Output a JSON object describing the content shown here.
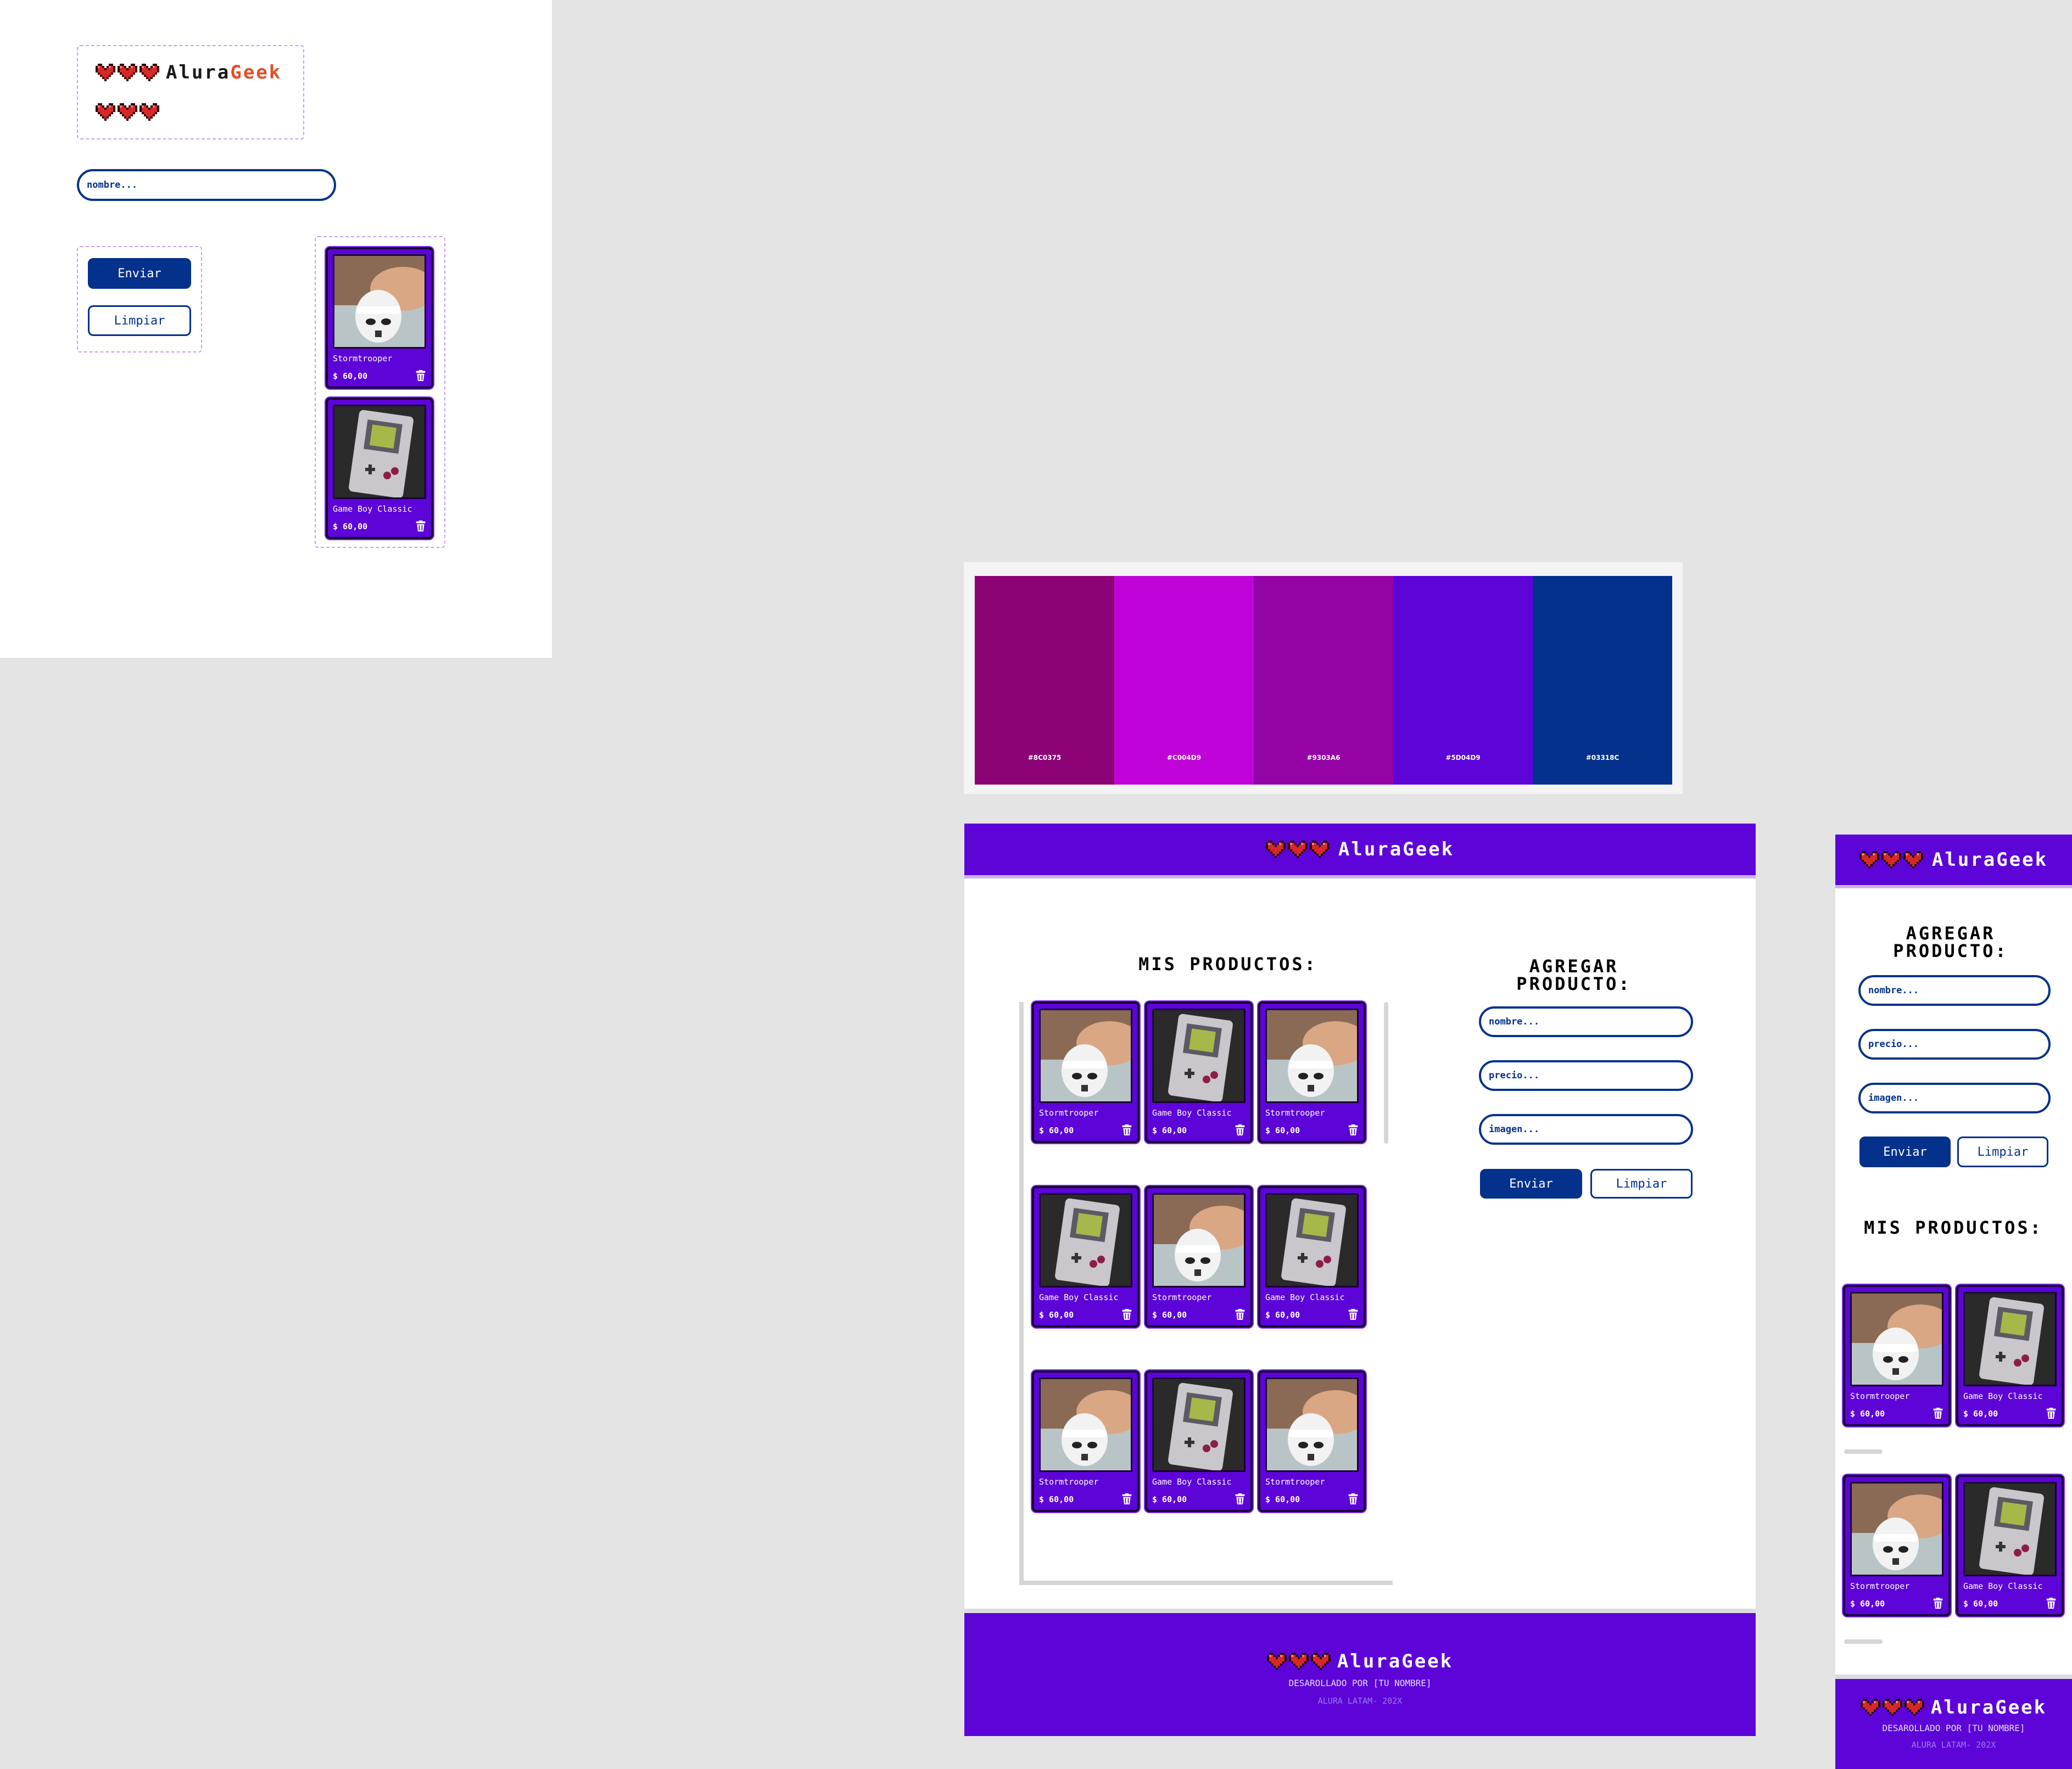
{
  "logo": {
    "part1": "Alura",
    "part2": "Geek",
    "full": "AluraGeek"
  },
  "form": {
    "name_placeholder": "nombre...",
    "price_placeholder": "precio...",
    "image_placeholder": "imagen...",
    "submit_label": "Enviar",
    "clear_label": "Limpiar"
  },
  "sections": {
    "products_title": "MIS PRODUCTOS:",
    "add_title_line1": "AGREGAR",
    "add_title_line2": "PRODUCTO:"
  },
  "products": [
    {
      "name": "Stormtrooper",
      "price": "$ 60,00",
      "image": "stormtrooper"
    },
    {
      "name": "Game Boy Classic",
      "price": "$ 60,00",
      "image": "gameboy"
    },
    {
      "name": "Stormtrooper",
      "price": "$ 60,00",
      "image": "stormtrooper"
    },
    {
      "name": "Game Boy Classic",
      "price": "$ 60,00",
      "image": "gameboy"
    },
    {
      "name": "Stormtrooper",
      "price": "$ 60,00",
      "image": "stormtrooper"
    },
    {
      "name": "Game Boy Classic",
      "price": "$ 60,00",
      "image": "gameboy"
    },
    {
      "name": "Stormtrooper",
      "price": "$ 60,00",
      "image": "stormtrooper"
    },
    {
      "name": "Game Boy Classic",
      "price": "$ 60,00",
      "image": "gameboy"
    },
    {
      "name": "Stormtrooper",
      "price": "$ 60,00",
      "image": "stormtrooper"
    }
  ],
  "palette": [
    {
      "label": "#8C0375",
      "color": "#8c0375"
    },
    {
      "label": "#C004D9",
      "color": "#c004d9"
    },
    {
      "label": "#9303A6",
      "color": "#9303a6"
    },
    {
      "label": "#5D04D9",
      "color": "#5d04d9"
    },
    {
      "label": "#03318C",
      "color": "#03318c"
    }
  ],
  "footer": {
    "developer": "DESAROLLADO POR [TU NOMBRE]",
    "credit": "ALURA LATAM- 202X"
  },
  "colors": {
    "primary": "#5d04d9",
    "navy": "#03318c",
    "accent": "#e44d26",
    "heart": "#d62828"
  },
  "icons": {
    "heart": "heart-icon",
    "trash": "trash-icon"
  }
}
